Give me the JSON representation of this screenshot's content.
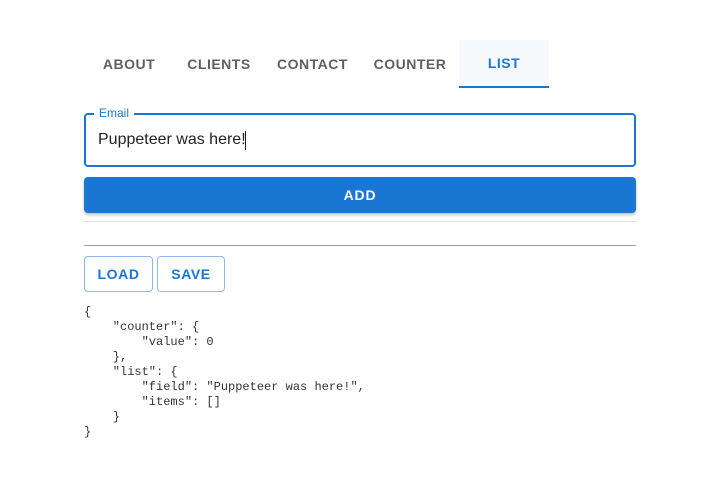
{
  "tabs": [
    {
      "label": "ABOUT",
      "active": false
    },
    {
      "label": "CLIENTS",
      "active": false
    },
    {
      "label": "CONTACT",
      "active": false
    },
    {
      "label": "COUNTER",
      "active": false
    },
    {
      "label": "LIST",
      "active": true
    }
  ],
  "form": {
    "email_label": "Email",
    "email_value": "Puppeteer was here!",
    "add_label": "ADD"
  },
  "actions": {
    "load_label": "LOAD",
    "save_label": "SAVE"
  },
  "state_json": "{\n    \"counter\": {\n        \"value\": 0\n    },\n    \"list\": {\n        \"field\": \"Puppeteer was here!\",\n        \"items\": []\n    }\n}",
  "colors": {
    "accent": "#1976d2",
    "tab_inactive": "#5f5f5f"
  }
}
